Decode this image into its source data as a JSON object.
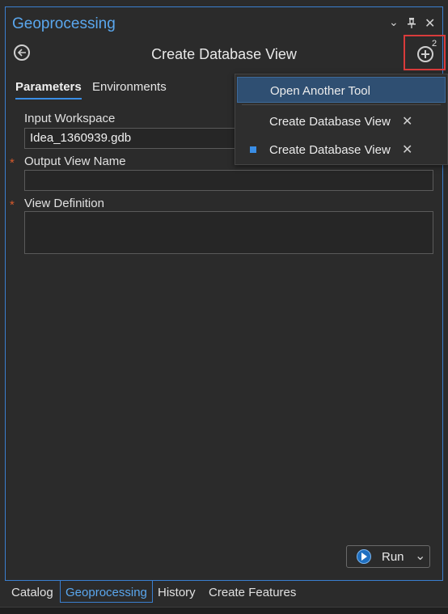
{
  "pane": {
    "title": "Geoprocessing"
  },
  "window_controls": {
    "dropdown": "⌄",
    "pin": "†",
    "close": "✕"
  },
  "header": {
    "tool_title": "Create Database View",
    "open_tools_count": "2"
  },
  "tabs": [
    {
      "label": "Parameters",
      "active": true
    },
    {
      "label": "Environments",
      "active": false
    }
  ],
  "params": {
    "input_workspace": {
      "label": "Input Workspace",
      "value": "Idea_1360939.gdb"
    },
    "output_view_name": {
      "label": "Output View Name",
      "value": "",
      "required": true
    },
    "view_definition": {
      "label": "View Definition",
      "value": "",
      "required": true
    }
  },
  "run": {
    "label": "Run"
  },
  "menu": {
    "items": [
      {
        "label": "Open Another Tool",
        "highlighted": true
      },
      {
        "label": "Create Database View",
        "closable": true,
        "active": false
      },
      {
        "label": "Create Database View",
        "closable": true,
        "active": true
      }
    ]
  },
  "bottom_tabs": [
    {
      "label": "Catalog",
      "active": false
    },
    {
      "label": "Geoprocessing",
      "active": true
    },
    {
      "label": "History",
      "active": false
    },
    {
      "label": "Create Features",
      "active": false
    }
  ],
  "colors": {
    "accent": "#3a8ee6",
    "required": "#d65a2c",
    "highlight_box": "#d93b3b"
  }
}
